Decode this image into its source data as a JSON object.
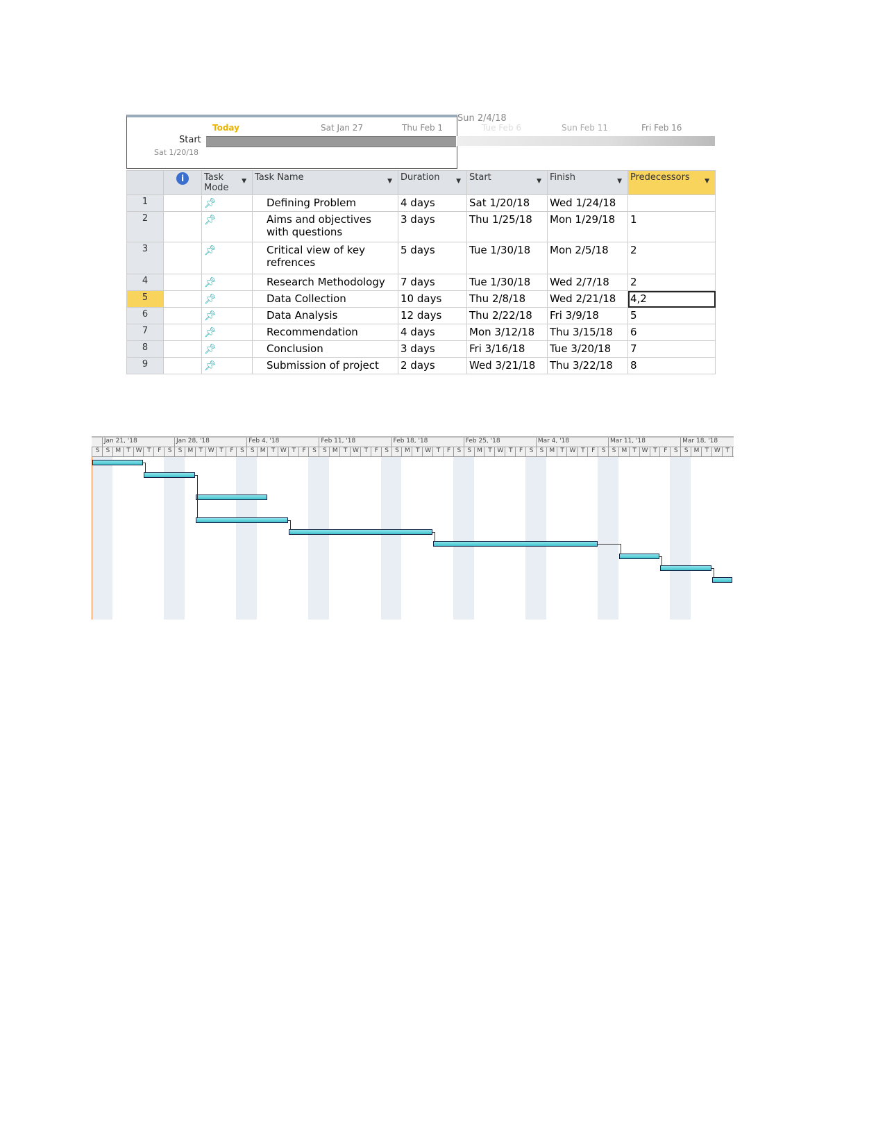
{
  "timeline": {
    "today": "Today",
    "start_label": "Start",
    "start_date": "Sat 1/20/18",
    "current": "Sun 2/4/18",
    "ticks": [
      "Sat Jan 27",
      "Thu Feb 1",
      "Tue Feb 6",
      "Sun Feb 11",
      "Fri Feb 16"
    ]
  },
  "table": {
    "headers": {
      "info": "i",
      "mode": "Task Mode",
      "name": "Task Name",
      "duration": "Duration",
      "start": "Start",
      "finish": "Finish",
      "predecessors": "Predecessors"
    },
    "rows": [
      {
        "id": "1",
        "name": "Defining Problem",
        "duration": "4 days",
        "start": "Sat 1/20/18",
        "finish": "Wed 1/24/18",
        "pred": ""
      },
      {
        "id": "2",
        "name": "Aims and objectives with questions",
        "duration": "3 days",
        "start": "Thu 1/25/18",
        "finish": "Mon 1/29/18",
        "pred": "1"
      },
      {
        "id": "3",
        "name": "Critical view of key refrences",
        "duration": "5 days",
        "start": "Tue 1/30/18",
        "finish": "Mon 2/5/18",
        "pred": "2"
      },
      {
        "id": "4",
        "name": "Research Methodology",
        "duration": "7 days",
        "start": "Tue 1/30/18",
        "finish": "Wed 2/7/18",
        "pred": "2"
      },
      {
        "id": "5",
        "name": "Data Collection",
        "duration": "10 days",
        "start": "Thu 2/8/18",
        "finish": "Wed 2/21/18",
        "pred": "4,2"
      },
      {
        "id": "6",
        "name": "Data Analysis",
        "duration": "12 days",
        "start": "Thu 2/22/18",
        "finish": "Fri 3/9/18",
        "pred": "5"
      },
      {
        "id": "7",
        "name": "Recommendation",
        "duration": "4 days",
        "start": "Mon 3/12/18",
        "finish": "Thu 3/15/18",
        "pred": "6"
      },
      {
        "id": "8",
        "name": "Conclusion",
        "duration": "3 days",
        "start": "Fri 3/16/18",
        "finish": "Tue 3/20/18",
        "pred": "7"
      },
      {
        "id": "9",
        "name": "Submission of project",
        "duration": "2 days",
        "start": "Wed 3/21/18",
        "finish": "Thu 3/22/18",
        "pred": "8"
      }
    ],
    "selected_row": "5"
  },
  "gantt": {
    "weeks": [
      "Jan 21, '18",
      "Jan 28, '18",
      "Feb 4, '18",
      "Feb 11, '18",
      "Feb 18, '18",
      "Feb 25, '18",
      "Mar 4, '18",
      "Mar 11, '18",
      "Mar 18, '18"
    ],
    "day_letters": [
      "S",
      "M",
      "T",
      "W",
      "T",
      "F",
      "S"
    ],
    "bars": [
      [
        "2018-01-20",
        "2018-01-24"
      ],
      [
        "2018-01-25",
        "2018-01-29"
      ],
      [
        "2018-01-30",
        "2018-02-05"
      ],
      [
        "2018-01-30",
        "2018-02-07"
      ],
      [
        "2018-02-08",
        "2018-02-21"
      ],
      [
        "2018-02-22",
        "2018-03-09"
      ],
      [
        "2018-03-12",
        "2018-03-15"
      ],
      [
        "2018-03-16",
        "2018-03-20"
      ],
      [
        "2018-03-21",
        "2018-03-22"
      ]
    ],
    "bar_color": "#3fc0cc"
  }
}
